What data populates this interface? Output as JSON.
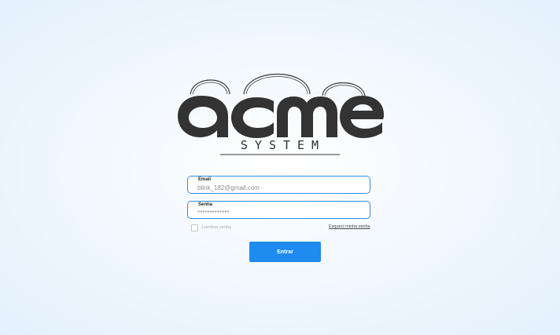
{
  "logo": {
    "word": "acme",
    "subtitle": "SYSTEM"
  },
  "form": {
    "email": {
      "label": "Email",
      "value": "blink_182@gmail.com"
    },
    "password": {
      "label": "Senha",
      "value": "*************"
    },
    "remember_label": "Lembrar senha",
    "forgot_label": "Esqueci minha senha",
    "submit_label": "Entrar"
  },
  "colors": {
    "accent": "#1e8bf0",
    "field_border": "#2f8de4",
    "logo": "#333333"
  }
}
